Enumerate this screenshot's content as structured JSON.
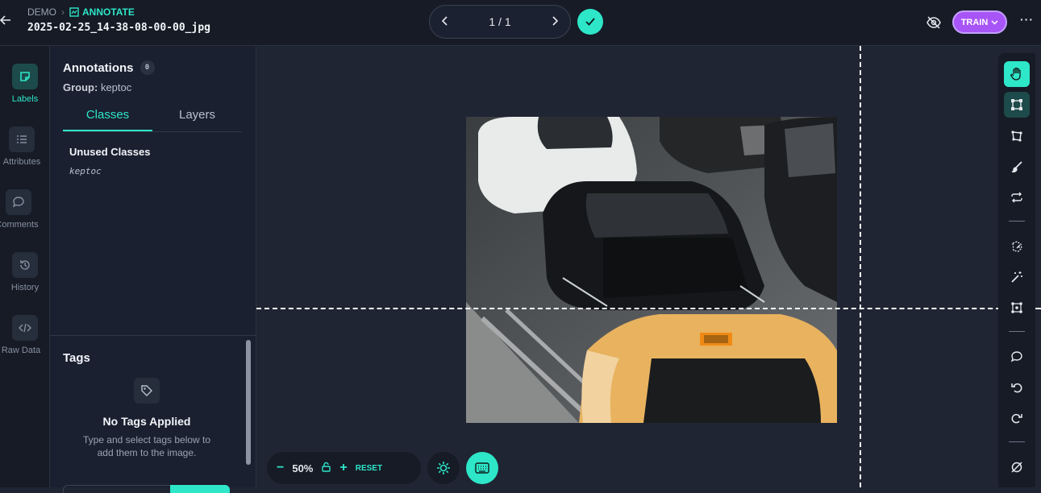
{
  "header": {
    "breadcrumb_root": "DEMO",
    "breadcrumb_current": "ANNOTATE",
    "filename": "2025-02-25_14-38-08-00-00_jpg",
    "pager_text": "1 / 1",
    "train_label": "TRAIN"
  },
  "left_rail": {
    "items": [
      {
        "label": "Labels",
        "icon": "label-icon"
      },
      {
        "label": "Attributes",
        "icon": "list-icon"
      },
      {
        "label": "Comments",
        "icon": "comment-icon"
      },
      {
        "label": "History",
        "icon": "history-icon"
      },
      {
        "label": "Raw Data",
        "icon": "code-icon"
      }
    ]
  },
  "annotations": {
    "title": "Annotations",
    "count": "0",
    "group_label": "Group:",
    "group_value": "keptoc",
    "tabs": [
      {
        "label": "Classes"
      },
      {
        "label": "Layers"
      }
    ],
    "unused_title": "Unused Classes",
    "unused_items": [
      "keptoc"
    ]
  },
  "tags": {
    "title": "Tags",
    "empty_title": "No Tags Applied",
    "empty_desc": "Type and select tags below to add them to the image."
  },
  "zoom": {
    "minus": "−",
    "percent": "50%",
    "plus": "+",
    "reset": "RESET"
  },
  "colors": {
    "accent": "#2ee6c8",
    "train": "#a855f7",
    "background": "#1f2533",
    "panel": "#1a2030"
  }
}
